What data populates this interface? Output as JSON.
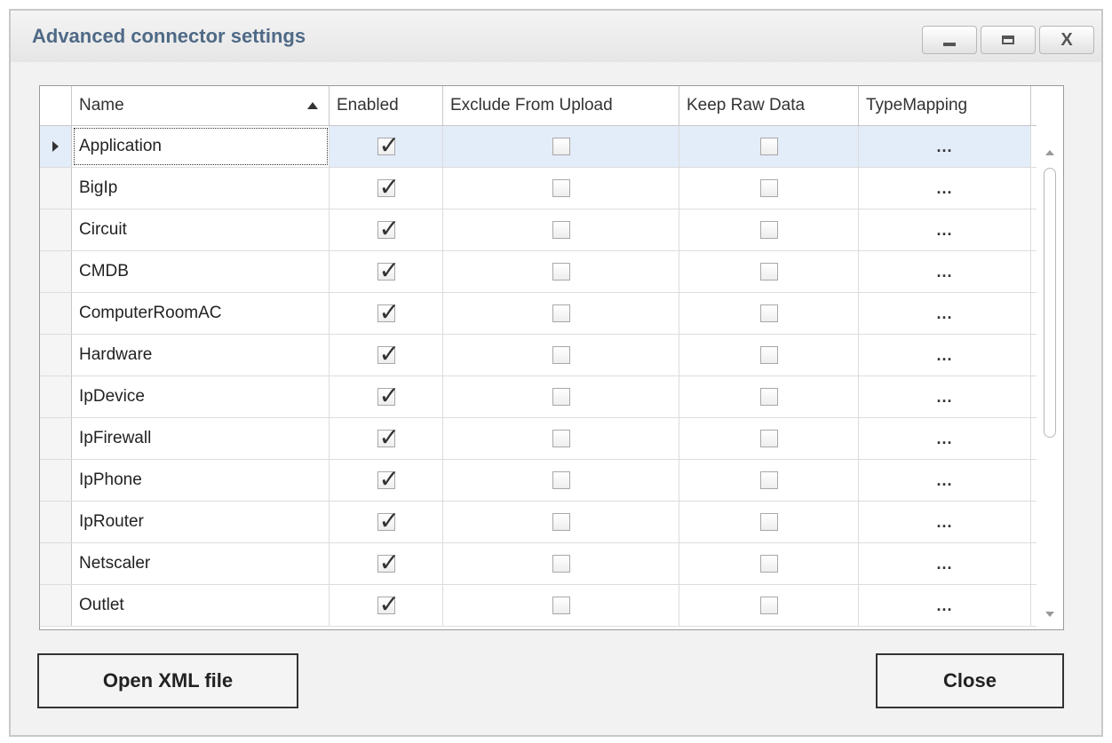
{
  "window": {
    "title": "Advanced connector settings",
    "controls": {
      "minimize": "minimize",
      "maximize": "maximize",
      "close": "X"
    }
  },
  "grid": {
    "columns": [
      "Name",
      "Enabled",
      "Exclude From Upload",
      "Keep Raw Data",
      "TypeMapping"
    ],
    "sort": {
      "column": "Name",
      "direction": "ascending"
    },
    "selected_row": 0,
    "rows": [
      {
        "name": "Application",
        "enabled": true,
        "exclude_from_upload": false,
        "keep_raw_data": false,
        "type_mapping": "..."
      },
      {
        "name": "BigIp",
        "enabled": true,
        "exclude_from_upload": false,
        "keep_raw_data": false,
        "type_mapping": "..."
      },
      {
        "name": "Circuit",
        "enabled": true,
        "exclude_from_upload": false,
        "keep_raw_data": false,
        "type_mapping": "..."
      },
      {
        "name": "CMDB",
        "enabled": true,
        "exclude_from_upload": false,
        "keep_raw_data": false,
        "type_mapping": "..."
      },
      {
        "name": "ComputerRoomAC",
        "enabled": true,
        "exclude_from_upload": false,
        "keep_raw_data": false,
        "type_mapping": "..."
      },
      {
        "name": "Hardware",
        "enabled": true,
        "exclude_from_upload": false,
        "keep_raw_data": false,
        "type_mapping": "..."
      },
      {
        "name": "IpDevice",
        "enabled": true,
        "exclude_from_upload": false,
        "keep_raw_data": false,
        "type_mapping": "..."
      },
      {
        "name": "IpFirewall",
        "enabled": true,
        "exclude_from_upload": false,
        "keep_raw_data": false,
        "type_mapping": "..."
      },
      {
        "name": "IpPhone",
        "enabled": true,
        "exclude_from_upload": false,
        "keep_raw_data": false,
        "type_mapping": "..."
      },
      {
        "name": "IpRouter",
        "enabled": true,
        "exclude_from_upload": false,
        "keep_raw_data": false,
        "type_mapping": "..."
      },
      {
        "name": "Netscaler",
        "enabled": true,
        "exclude_from_upload": false,
        "keep_raw_data": false,
        "type_mapping": "..."
      },
      {
        "name": "Outlet",
        "enabled": true,
        "exclude_from_upload": false,
        "keep_raw_data": false,
        "type_mapping": "..."
      }
    ]
  },
  "buttons": {
    "open_xml": "Open XML file",
    "close": "Close"
  },
  "colors": {
    "title": "#4f6a86",
    "selected_row": "#e3ecf9"
  }
}
